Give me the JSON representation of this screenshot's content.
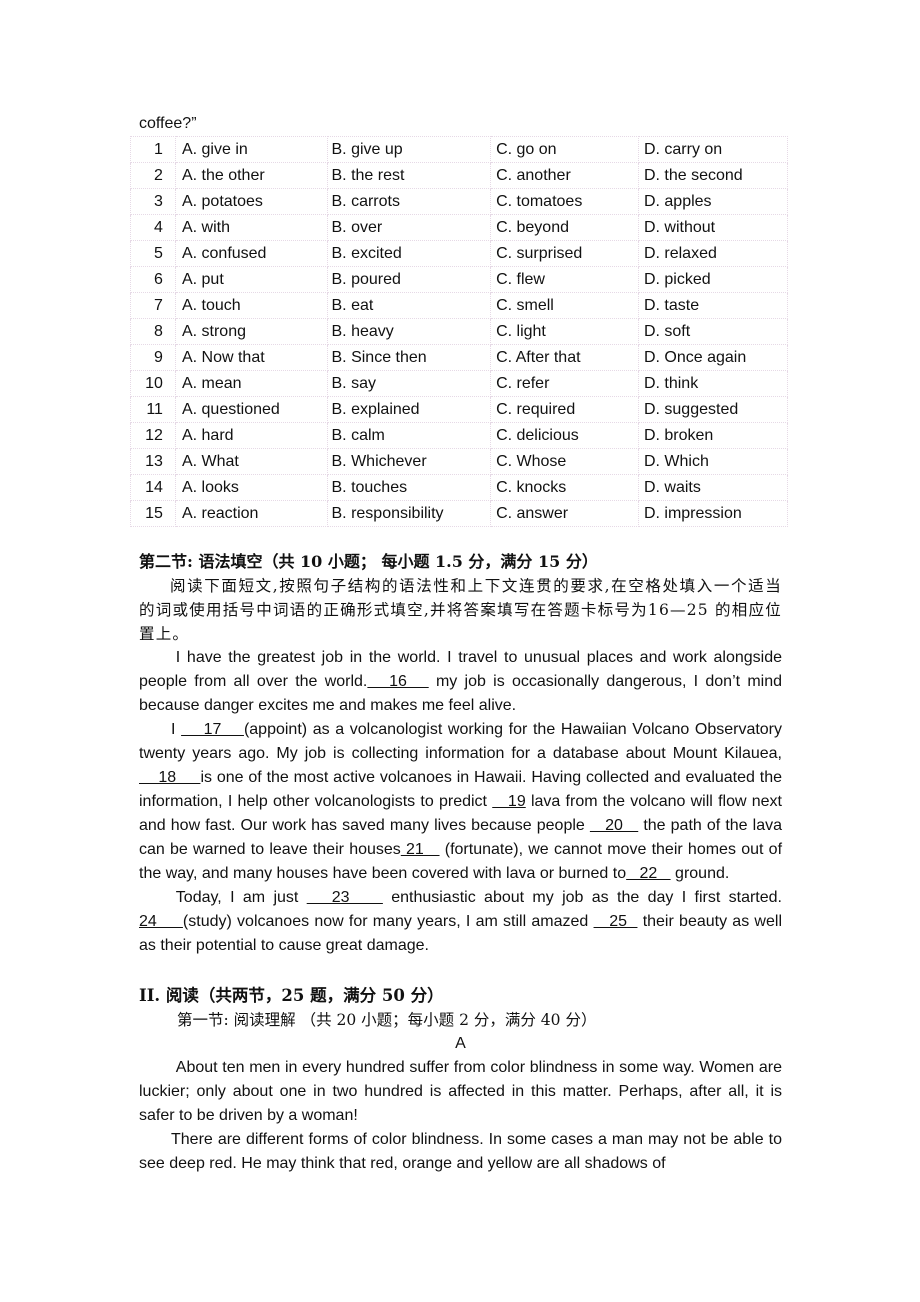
{
  "lead_line": "coffee?”",
  "options_table": {
    "rows": [
      {
        "num": "1",
        "a": "A. give in",
        "b": "B. give up",
        "c": "C. go on",
        "d": "D. carry on"
      },
      {
        "num": "2",
        "a": "A. the other",
        "b": "B. the rest",
        "c": "C. another",
        "d": "D. the second"
      },
      {
        "num": "3",
        "a": "A. potatoes",
        "b": "B. carrots",
        "c": "C. tomatoes",
        "d": "D. apples"
      },
      {
        "num": "4",
        "a": "A. with",
        "b": "B. over",
        "c": "C. beyond",
        "d": "D. without"
      },
      {
        "num": "5",
        "a": "A. confused",
        "b": "B. excited",
        "c": "C. surprised",
        "d": "D. relaxed"
      },
      {
        "num": "6",
        "a": "A. put",
        "b": "B. poured",
        "c": "C. flew",
        "d": "D. picked"
      },
      {
        "num": "7",
        "a": "A. touch",
        "b": "B. eat",
        "c": "C. smell",
        "d": "D. taste"
      },
      {
        "num": "8",
        "a": "A. strong",
        "b": "B. heavy",
        "c": "C. light",
        "d": "D. soft"
      },
      {
        "num": "9",
        "a": "A. Now that",
        "b": "B. Since then",
        "c": "C. After that",
        "d": "D. Once again"
      },
      {
        "num": "10",
        "a": "A. mean",
        "b": "B. say",
        "c": "C. refer",
        "d": "D. think"
      },
      {
        "num": "11",
        "a": "A. questioned",
        "b": "B. explained",
        "c": "C. required",
        "d": "D. suggested"
      },
      {
        "num": "12",
        "a": "A. hard",
        "b": "B. calm",
        "c": "C. delicious",
        "d": "D. broken"
      },
      {
        "num": "13",
        "a": "A. What",
        "b": "B. Whichever",
        "c": "C. Whose",
        "d": "D. Which"
      },
      {
        "num": "14",
        "a": "A. looks",
        "b": "B. touches",
        "c": "C. knocks",
        "d": "D. waits"
      },
      {
        "num": "15",
        "a": "A. reaction",
        "b": "B. responsibility",
        "c": "C. answer",
        "d": "D. impression"
      }
    ]
  },
  "section2": {
    "title": "第二节: 语法填空（共 10 小题；  每小题 1.5 分，满分 15 分）",
    "instructions": "阅读下面短文,按照句子结构的语法性和上下文连贯的要求,在空格处填入一个适当的词或使用括号中词语的正确形式填空,并将答案填写在答题卡标号为16—25 的相应位置上。",
    "p1": {
      "t1": "I have the greatest job in the world. I travel to unusual places and work alongside people from all over the world.",
      "b16": "   16   ",
      "t2": " my job is occasionally dangerous, I don’t mind because danger excites me and makes me feel alive."
    },
    "p2": {
      "t1": "I ",
      "b17": "    17    ",
      "t2": "(appoint) as a volcanologist working for the Hawaiian Volcano Observatory twenty years ago. My job is collecting information for a database about Mount Kilauea, ",
      "b18": "    18     ",
      "t3": "is one of the most active volcanoes in Hawaii. Having collected and evaluated the information, I help other volcanologists to predict ",
      "b19": "   19",
      "t4": " lava from the volcano will flow next and how fast. Our work has saved many lives because people ",
      "b20": "   20   ",
      "t5": " the path of the lava can be warned to leave their houses",
      "b21": " 21   ",
      "t6": " (fortunate), we cannot move their homes out of the way, and many houses have been covered with lava or burned to",
      "b22": "   22   ",
      "t7": " ground."
    },
    "p3": {
      "t1": "Today, I am just ",
      "b23": "   23    ",
      "t2": " enthusiastic about my job as the day I first started. ",
      "b24": "24     ",
      "t3": "(study) volcanoes now for many years, I am still amazed ",
      "b25": "   25  ",
      "t4": " their beauty as well as their potential to cause great damage."
    }
  },
  "part2": {
    "title": "II. 阅读（共两节，25 题，满分 50 分）",
    "sub_title": "第一节: 阅读理解 （共 20 小题；每小题 2 分，满分 40 分）",
    "passage_label": "A",
    "paragraphs": [
      "About ten men in every hundred suffer from color blindness in some way. Women are luckier; only about one in two hundred is affected in this matter. Perhaps, after all, it is safer to be driven by a woman!",
      "There are different forms of color blindness. In some cases a man may not be able to see deep red. He may think that red, orange and yellow are all shadows of"
    ]
  }
}
